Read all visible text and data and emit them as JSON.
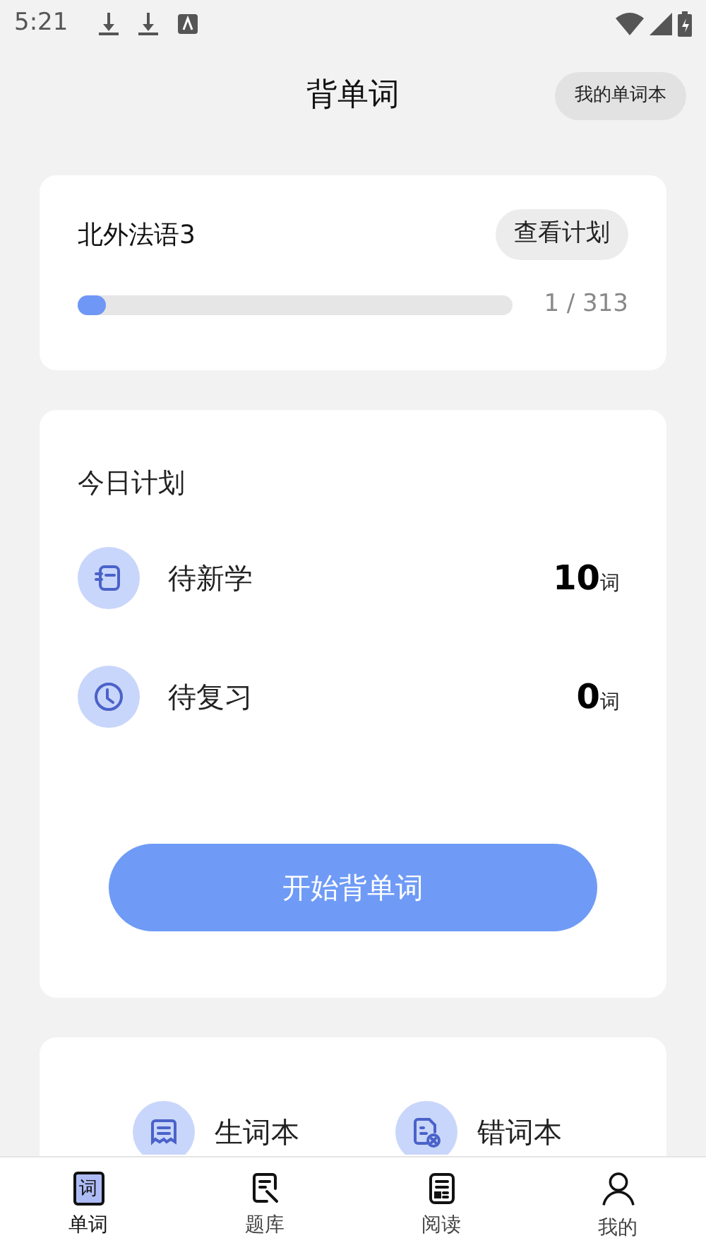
{
  "status_bar": {
    "time": "5:21"
  },
  "header": {
    "title": "背单词",
    "action": "我的单词本"
  },
  "book": {
    "name": "北外法语3",
    "action": "查看计划",
    "level": 0.003,
    "progress": "1 / 313"
  },
  "plan": {
    "title": "今日计划",
    "items": [
      {
        "kind": "new",
        "label": "待新学",
        "count": "10",
        "unit": "词"
      },
      {
        "kind": "review",
        "label": "待复习",
        "count": "0",
        "unit": "词"
      }
    ],
    "start_button": "开始背单词"
  },
  "shortcuts": [
    {
      "kind": "notebook",
      "label": "生词本"
    },
    {
      "kind": "mistakes",
      "label": "错词本"
    }
  ],
  "tabs": [
    {
      "kind": "words",
      "label": "单词",
      "icon_text": "词",
      "selected": true
    },
    {
      "kind": "questions",
      "label": "题库",
      "selected": false
    },
    {
      "kind": "reading",
      "label": "阅读",
      "selected": false
    },
    {
      "kind": "me",
      "label": "我的",
      "selected": false
    }
  ]
}
